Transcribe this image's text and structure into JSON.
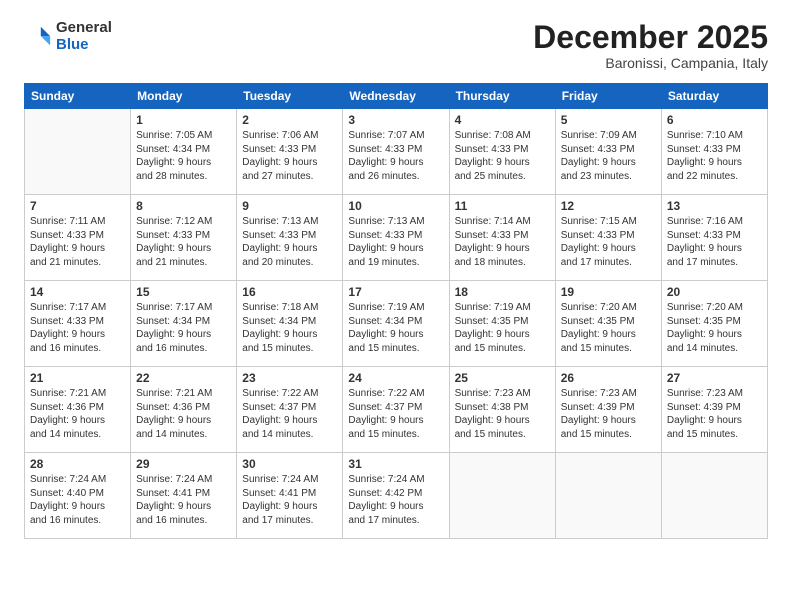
{
  "logo": {
    "general": "General",
    "blue": "Blue"
  },
  "header": {
    "month": "December 2025",
    "location": "Baronissi, Campania, Italy"
  },
  "weekdays": [
    "Sunday",
    "Monday",
    "Tuesday",
    "Wednesday",
    "Thursday",
    "Friday",
    "Saturday"
  ],
  "weeks": [
    [
      {
        "day": "",
        "info": ""
      },
      {
        "day": "1",
        "info": "Sunrise: 7:05 AM\nSunset: 4:34 PM\nDaylight: 9 hours\nand 28 minutes."
      },
      {
        "day": "2",
        "info": "Sunrise: 7:06 AM\nSunset: 4:33 PM\nDaylight: 9 hours\nand 27 minutes."
      },
      {
        "day": "3",
        "info": "Sunrise: 7:07 AM\nSunset: 4:33 PM\nDaylight: 9 hours\nand 26 minutes."
      },
      {
        "day": "4",
        "info": "Sunrise: 7:08 AM\nSunset: 4:33 PM\nDaylight: 9 hours\nand 25 minutes."
      },
      {
        "day": "5",
        "info": "Sunrise: 7:09 AM\nSunset: 4:33 PM\nDaylight: 9 hours\nand 23 minutes."
      },
      {
        "day": "6",
        "info": "Sunrise: 7:10 AM\nSunset: 4:33 PM\nDaylight: 9 hours\nand 22 minutes."
      }
    ],
    [
      {
        "day": "7",
        "info": "Sunrise: 7:11 AM\nSunset: 4:33 PM\nDaylight: 9 hours\nand 21 minutes."
      },
      {
        "day": "8",
        "info": "Sunrise: 7:12 AM\nSunset: 4:33 PM\nDaylight: 9 hours\nand 21 minutes."
      },
      {
        "day": "9",
        "info": "Sunrise: 7:13 AM\nSunset: 4:33 PM\nDaylight: 9 hours\nand 20 minutes."
      },
      {
        "day": "10",
        "info": "Sunrise: 7:13 AM\nSunset: 4:33 PM\nDaylight: 9 hours\nand 19 minutes."
      },
      {
        "day": "11",
        "info": "Sunrise: 7:14 AM\nSunset: 4:33 PM\nDaylight: 9 hours\nand 18 minutes."
      },
      {
        "day": "12",
        "info": "Sunrise: 7:15 AM\nSunset: 4:33 PM\nDaylight: 9 hours\nand 17 minutes."
      },
      {
        "day": "13",
        "info": "Sunrise: 7:16 AM\nSunset: 4:33 PM\nDaylight: 9 hours\nand 17 minutes."
      }
    ],
    [
      {
        "day": "14",
        "info": "Sunrise: 7:17 AM\nSunset: 4:33 PM\nDaylight: 9 hours\nand 16 minutes."
      },
      {
        "day": "15",
        "info": "Sunrise: 7:17 AM\nSunset: 4:34 PM\nDaylight: 9 hours\nand 16 minutes."
      },
      {
        "day": "16",
        "info": "Sunrise: 7:18 AM\nSunset: 4:34 PM\nDaylight: 9 hours\nand 15 minutes."
      },
      {
        "day": "17",
        "info": "Sunrise: 7:19 AM\nSunset: 4:34 PM\nDaylight: 9 hours\nand 15 minutes."
      },
      {
        "day": "18",
        "info": "Sunrise: 7:19 AM\nSunset: 4:35 PM\nDaylight: 9 hours\nand 15 minutes."
      },
      {
        "day": "19",
        "info": "Sunrise: 7:20 AM\nSunset: 4:35 PM\nDaylight: 9 hours\nand 15 minutes."
      },
      {
        "day": "20",
        "info": "Sunrise: 7:20 AM\nSunset: 4:35 PM\nDaylight: 9 hours\nand 14 minutes."
      }
    ],
    [
      {
        "day": "21",
        "info": "Sunrise: 7:21 AM\nSunset: 4:36 PM\nDaylight: 9 hours\nand 14 minutes."
      },
      {
        "day": "22",
        "info": "Sunrise: 7:21 AM\nSunset: 4:36 PM\nDaylight: 9 hours\nand 14 minutes."
      },
      {
        "day": "23",
        "info": "Sunrise: 7:22 AM\nSunset: 4:37 PM\nDaylight: 9 hours\nand 14 minutes."
      },
      {
        "day": "24",
        "info": "Sunrise: 7:22 AM\nSunset: 4:37 PM\nDaylight: 9 hours\nand 15 minutes."
      },
      {
        "day": "25",
        "info": "Sunrise: 7:23 AM\nSunset: 4:38 PM\nDaylight: 9 hours\nand 15 minutes."
      },
      {
        "day": "26",
        "info": "Sunrise: 7:23 AM\nSunset: 4:39 PM\nDaylight: 9 hours\nand 15 minutes."
      },
      {
        "day": "27",
        "info": "Sunrise: 7:23 AM\nSunset: 4:39 PM\nDaylight: 9 hours\nand 15 minutes."
      }
    ],
    [
      {
        "day": "28",
        "info": "Sunrise: 7:24 AM\nSunset: 4:40 PM\nDaylight: 9 hours\nand 16 minutes."
      },
      {
        "day": "29",
        "info": "Sunrise: 7:24 AM\nSunset: 4:41 PM\nDaylight: 9 hours\nand 16 minutes."
      },
      {
        "day": "30",
        "info": "Sunrise: 7:24 AM\nSunset: 4:41 PM\nDaylight: 9 hours\nand 17 minutes."
      },
      {
        "day": "31",
        "info": "Sunrise: 7:24 AM\nSunset: 4:42 PM\nDaylight: 9 hours\nand 17 minutes."
      },
      {
        "day": "",
        "info": ""
      },
      {
        "day": "",
        "info": ""
      },
      {
        "day": "",
        "info": ""
      }
    ]
  ]
}
